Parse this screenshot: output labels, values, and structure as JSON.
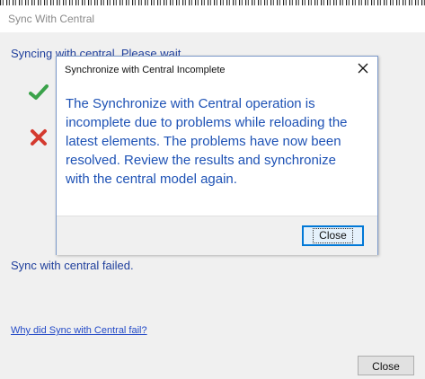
{
  "outer_window": {
    "title": "Sync With Central",
    "syncing_text": "Syncing with central. Please wait...",
    "failed_text": "Sync with central failed.",
    "help_link": "Why did Sync with Central fail?",
    "close_button": "Close",
    "step_icons": [
      "check-icon",
      "x-icon"
    ]
  },
  "dialog": {
    "title": "Synchronize with Central Incomplete",
    "message": "The Synchronize with Central operation is incomplete due to problems while reloading the latest elements.  The problems have now been resolved.  Review the results and synchronize with the central model again.",
    "close_button": "Close"
  },
  "colors": {
    "text_blue": "#1f3f9c",
    "link_blue": "#2249c7",
    "message_blue": "#1e52b5",
    "check_green": "#3aa24a",
    "x_red": "#d43a2f"
  }
}
